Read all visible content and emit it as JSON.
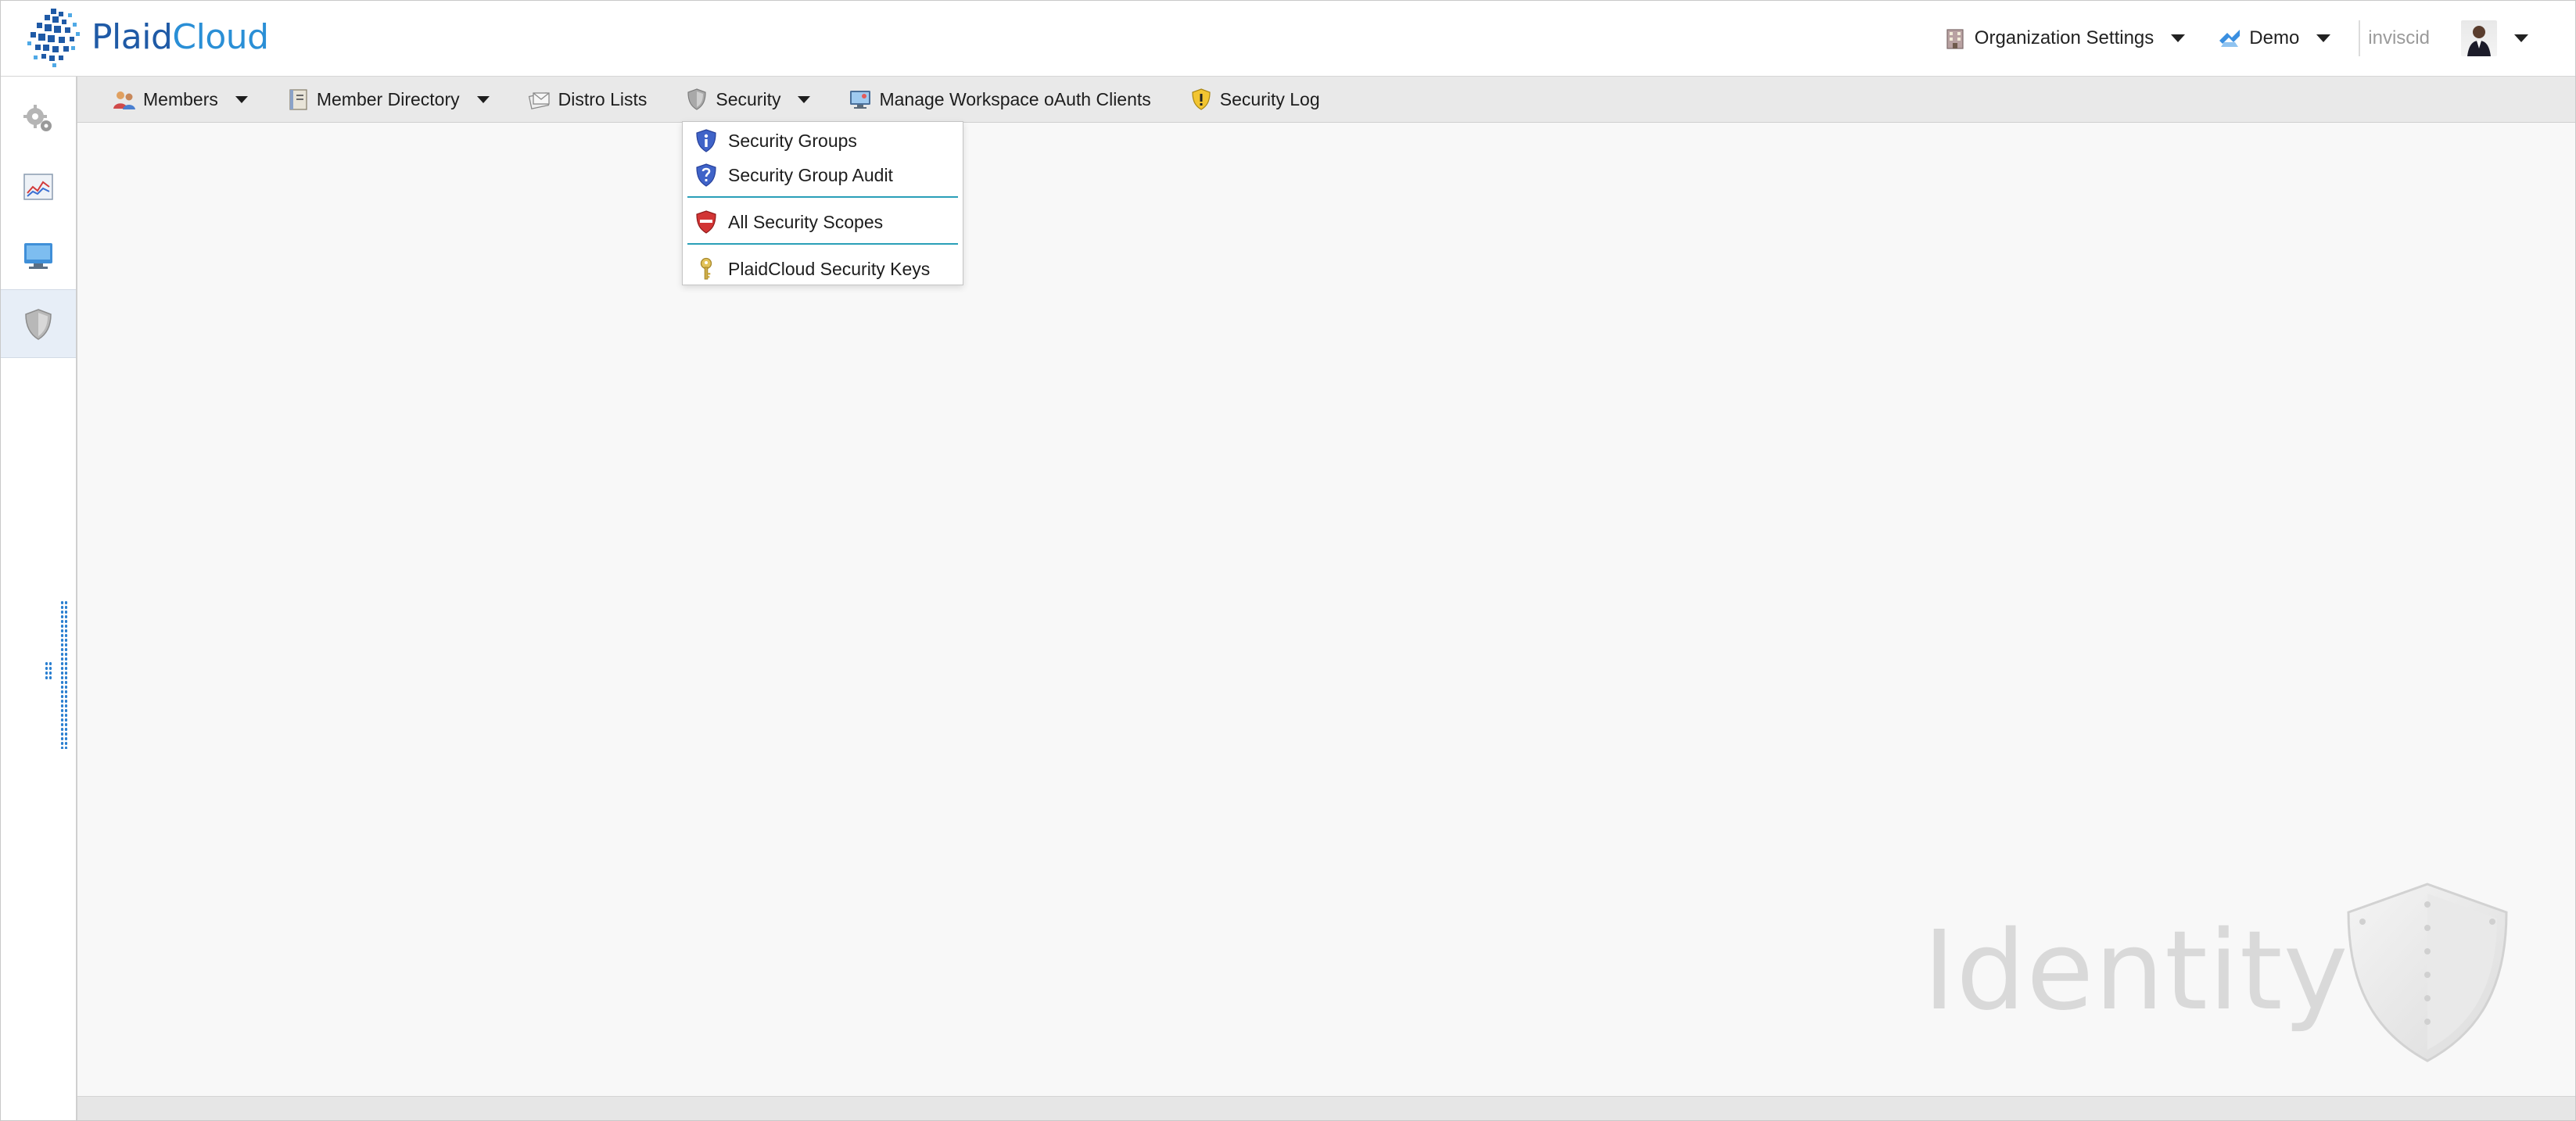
{
  "app": {
    "logo_primary": "Plaid",
    "logo_secondary": "Cloud"
  },
  "header": {
    "org_settings_label": "Organization Settings",
    "workspace_label": "Demo",
    "username": "inviscid"
  },
  "rail": {
    "items": [
      {
        "icon": "gears-icon",
        "active": false
      },
      {
        "icon": "analytics-chart-icon",
        "active": false
      },
      {
        "icon": "monitor-folder-icon",
        "active": false
      },
      {
        "icon": "shield-icon",
        "active": true
      }
    ]
  },
  "toolbar": {
    "members_label": "Members",
    "member_directory_label": "Member Directory",
    "distro_lists_label": "Distro Lists",
    "security_label": "Security",
    "oauth_clients_label": "Manage Workspace oAuth Clients",
    "security_log_label": "Security Log"
  },
  "security_menu": {
    "items": [
      {
        "label": "Security Groups",
        "icon": "info-shield-icon"
      },
      {
        "label": "Security Group Audit",
        "icon": "question-shield-icon"
      },
      {
        "label": "All Security Scopes",
        "icon": "red-shield-icon"
      },
      {
        "label": "PlaidCloud Security Keys",
        "icon": "key-icon"
      }
    ]
  },
  "main": {
    "watermark": "Identity"
  },
  "colors": {
    "accent_blue": "#2a7fd0",
    "separator_teal": "#2a9fb8",
    "toolbar_bg": "#e9e9e9",
    "main_bg": "#f8f8f8"
  }
}
